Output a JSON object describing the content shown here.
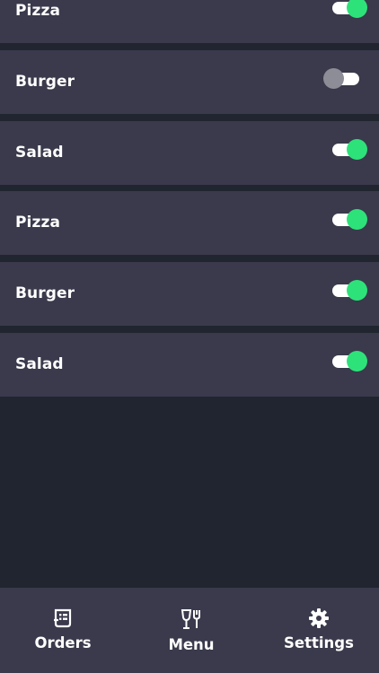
{
  "menu_items": [
    {
      "label": "Pizza",
      "enabled": true
    },
    {
      "label": "Burger",
      "enabled": false
    },
    {
      "label": "Salad",
      "enabled": true
    },
    {
      "label": "Pizza",
      "enabled": true
    },
    {
      "label": "Burger",
      "enabled": true
    },
    {
      "label": "Salad",
      "enabled": true
    }
  ],
  "tabbar": {
    "tabs": [
      {
        "label": "Orders",
        "icon": "receipt-icon"
      },
      {
        "label": "Menu",
        "icon": "glass-fork-icon"
      },
      {
        "label": "Settings",
        "icon": "gear-icon"
      }
    ]
  },
  "colors": {
    "background": "#202530",
    "row": "#3a3a4c",
    "toggle_on": "#2ee27a",
    "toggle_off": "#8c8d96"
  }
}
